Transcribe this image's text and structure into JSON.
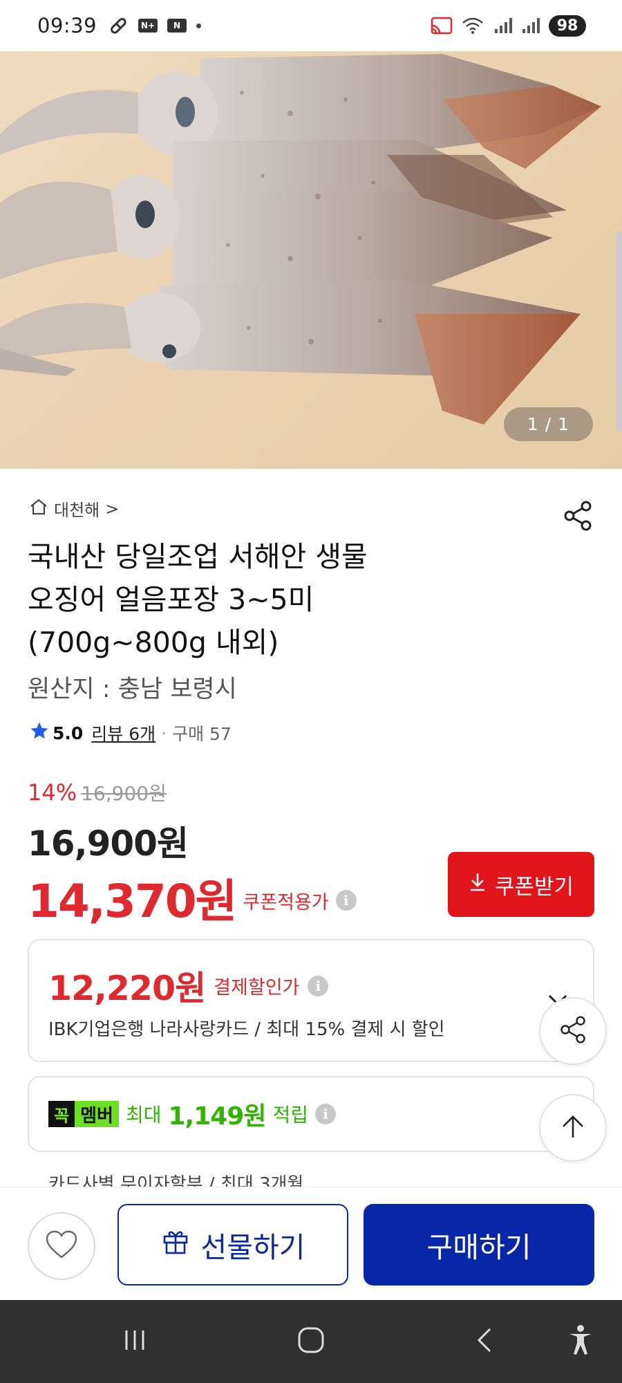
{
  "status_bar": {
    "time": "09:39",
    "left_icons": [
      "key-icon",
      "nplus-icon",
      "naver-icon",
      "notification-dot-icon"
    ],
    "right_icons": [
      "cast-icon",
      "wifi-icon",
      "signal-icon",
      "signal-icon"
    ],
    "battery": "98"
  },
  "hero": {
    "pager": "1 / 1"
  },
  "seller": {
    "name": "대천해",
    "chevron": ">"
  },
  "product": {
    "title_line1": "국내산 당일조업 서해안 생물",
    "title_line2": "오징어 얼음포장 3~5미",
    "title_line3": "(700g~800g 내외)",
    "origin": "원산지 : 충남 보령시"
  },
  "rating": {
    "score": "5.0",
    "review": "리뷰 6개",
    "separator": "·",
    "purchase": "구매 57"
  },
  "price": {
    "discount_pct": "14%",
    "original": "16,900원",
    "main": "16,900원",
    "coupon_price": "14,370원",
    "coupon_label": "쿠폰적용가",
    "coupon_button": "쿠폰받기"
  },
  "payment": {
    "price": "12,220원",
    "label": "결제할인가",
    "desc": "IBK기업은행 나라사랑카드 / 최대 15% 결제 시 할인"
  },
  "member": {
    "badge_left": "꼭",
    "badge_right": "멤버",
    "prefix": "최대",
    "amount": "1,149원",
    "suffix": "적립"
  },
  "cut_text": "카드사별 무이자할부 / 최대 3개월",
  "actions": {
    "gift": "선물하기",
    "buy": "구매하기"
  },
  "colors": {
    "accent_red": "#e0282f",
    "coupon_button": "#e1141c",
    "buy_blue": "#0527a8",
    "member_green": "#2fb400"
  }
}
